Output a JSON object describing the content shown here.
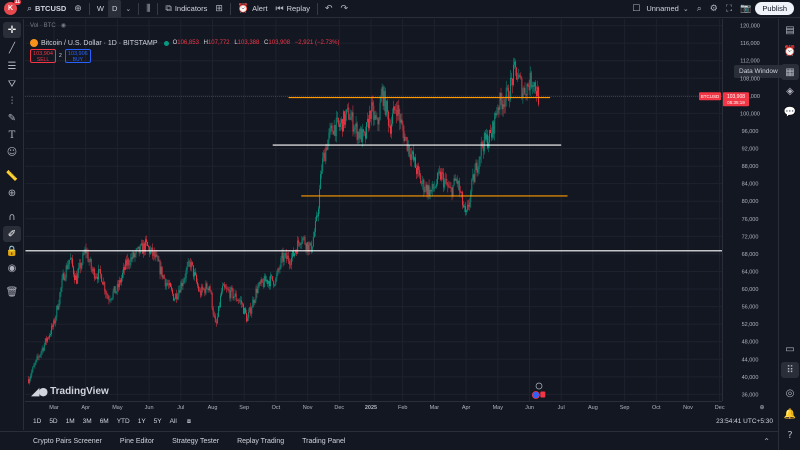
{
  "topbar": {
    "symbol": "BTCUSD",
    "avatar_letter": "K",
    "avatar_badge": "11",
    "timeframes": [
      "W",
      "D"
    ],
    "indicators": "Indicators",
    "alert": "Alert",
    "replay": "Replay",
    "layout_name": "Unnamed",
    "publish": "Publish"
  },
  "legend": {
    "volume_row": "Vol · BTC",
    "title": "Bitcoin / U.S. Dollar · 1D · BITSTAMP",
    "o_label": "O",
    "o": "106,853",
    "h_label": "H",
    "h": "107,772",
    "l_label": "L",
    "l": "103,388",
    "c_label": "C",
    "c": "103,908",
    "change": "−2,921 (−2.73%)",
    "sell_price": "103,904",
    "sell_label": "SELL",
    "spread": "2",
    "buy_price": "103,906",
    "buy_label": "BUY"
  },
  "tooltip": "Data Window",
  "watermark": "TradingView",
  "price_tag": {
    "symbol": "BTCUSD",
    "price": "103,908",
    "countdown": "05:35:19"
  },
  "bottombar": {
    "ranges": [
      "1D",
      "5D",
      "1M",
      "3M",
      "6M",
      "YTD",
      "1Y",
      "5Y",
      "All"
    ],
    "clock": "23:54:41 UTC+5:30"
  },
  "bottompanel": {
    "tabs": [
      "Crypto Pairs Screener",
      "Pine Editor",
      "Strategy Tester",
      "Replay Trading",
      "Trading Panel"
    ]
  },
  "colors": {
    "up": "#089981",
    "down": "#f23645",
    "bg": "#131722",
    "orange_line": "#ff9800",
    "white_line": "#ffffff"
  },
  "chart_data": {
    "type": "candlestick",
    "y_ticks": [
      120000,
      116000,
      112000,
      108000,
      104000,
      100000,
      96000,
      92000,
      88000,
      84000,
      80000,
      76000,
      72000,
      68000,
      64000,
      60000,
      56000,
      52000,
      48000,
      44000,
      40000,
      36000
    ],
    "y_tick_labels": [
      "120,000",
      "116,000",
      "112,000",
      "108,000",
      "104,000",
      "100,000",
      "96,000",
      "92,000",
      "88,000",
      "84,000",
      "80,000",
      "76,000",
      "72,000",
      "68,000",
      "64,000",
      "60,000",
      "56,000",
      "52,000",
      "48,000",
      "44,000",
      "40,000",
      "36,000"
    ],
    "ylim": [
      34500,
      121500
    ],
    "x_ticks": [
      {
        "label": "Mar",
        "month": 0
      },
      {
        "label": "Apr",
        "month": 1
      },
      {
        "label": "May",
        "month": 2
      },
      {
        "label": "Jun",
        "month": 3
      },
      {
        "label": "Jul",
        "month": 4
      },
      {
        "label": "Aug",
        "month": 5
      },
      {
        "label": "Sep",
        "month": 6
      },
      {
        "label": "Oct",
        "month": 7
      },
      {
        "label": "Nov",
        "month": 8
      },
      {
        "label": "Dec",
        "month": 9
      },
      {
        "label": "2025",
        "month": 10
      },
      {
        "label": "Feb",
        "month": 11
      },
      {
        "label": "Mar",
        "month": 12
      },
      {
        "label": "Apr",
        "month": 13
      },
      {
        "label": "May",
        "month": 14
      },
      {
        "label": "Jun",
        "month": 15
      },
      {
        "label": "Jul",
        "month": 16
      },
      {
        "label": "Aug",
        "month": 17
      },
      {
        "label": "Sep",
        "month": 18
      },
      {
        "label": "Oct",
        "month": 19
      },
      {
        "label": "Nov",
        "month": 20
      },
      {
        "label": "Dec",
        "month": 21
      }
    ],
    "price_path": [
      [
        -0.8,
        39500
      ],
      [
        -0.4,
        46000
      ],
      [
        0.0,
        52000
      ],
      [
        0.3,
        63000
      ],
      [
        0.5,
        67000
      ],
      [
        0.7,
        62000
      ],
      [
        1.0,
        69000
      ],
      [
        1.2,
        64000
      ],
      [
        1.5,
        63000
      ],
      [
        1.7,
        58000
      ],
      [
        2.0,
        60000
      ],
      [
        2.3,
        66000
      ],
      [
        2.6,
        68000
      ],
      [
        2.9,
        70000
      ],
      [
        3.2,
        67000
      ],
      [
        3.5,
        62000
      ],
      [
        3.8,
        58000
      ],
      [
        4.0,
        61000
      ],
      [
        4.3,
        66000
      ],
      [
        4.6,
        59000
      ],
      [
        4.9,
        61000
      ],
      [
        5.1,
        51000
      ],
      [
        5.3,
        60000
      ],
      [
        5.6,
        59000
      ],
      [
        5.9,
        57000
      ],
      [
        6.1,
        53000
      ],
      [
        6.4,
        60000
      ],
      [
        6.7,
        62000
      ],
      [
        7.0,
        62000
      ],
      [
        7.2,
        67000
      ],
      [
        7.5,
        67000
      ],
      [
        7.8,
        72000
      ],
      [
        8.1,
        69000
      ],
      [
        8.3,
        76000
      ],
      [
        8.45,
        88000
      ],
      [
        8.6,
        93000
      ],
      [
        8.8,
        97000
      ],
      [
        9.0,
        97000
      ],
      [
        9.3,
        100000
      ],
      [
        9.55,
        96000
      ],
      [
        9.8,
        94000
      ],
      [
        10.0,
        101000
      ],
      [
        10.2,
        97000
      ],
      [
        10.35,
        105000
      ],
      [
        10.6,
        97000
      ],
      [
        10.8,
        102000
      ],
      [
        11.0,
        96000
      ],
      [
        11.3,
        90000
      ],
      [
        11.6,
        84000
      ],
      [
        11.9,
        82000
      ],
      [
        12.2,
        86000
      ],
      [
        12.5,
        82000
      ],
      [
        12.7,
        85000
      ],
      [
        13.0,
        76000
      ],
      [
        13.2,
        84000
      ],
      [
        13.5,
        93000
      ],
      [
        13.8,
        95000
      ],
      [
        14.0,
        102000
      ],
      [
        14.3,
        104000
      ],
      [
        14.55,
        110000
      ],
      [
        14.8,
        105000
      ],
      [
        15.1,
        108000
      ],
      [
        15.3,
        103500
      ]
    ],
    "annotations": [
      {
        "type": "hline",
        "color": "#ff9800",
        "price": 103600,
        "x_from_month": 7.4,
        "x_to_month": 15.65
      },
      {
        "type": "hline",
        "color": "#ffffff",
        "price": 92800,
        "x_from_month": 6.9,
        "x_to_month": 16.0
      },
      {
        "type": "hline",
        "color": "#ff9800",
        "price": 81200,
        "x_from_month": 7.8,
        "x_to_month": 16.2
      },
      {
        "type": "hline",
        "color": "#ffffff",
        "price": 68700,
        "x_from_month": -0.9,
        "x_to_month": 22.6
      },
      {
        "type": "hline_thin",
        "color": "#f23645",
        "price": 103908
      }
    ],
    "current_price": 103908
  }
}
